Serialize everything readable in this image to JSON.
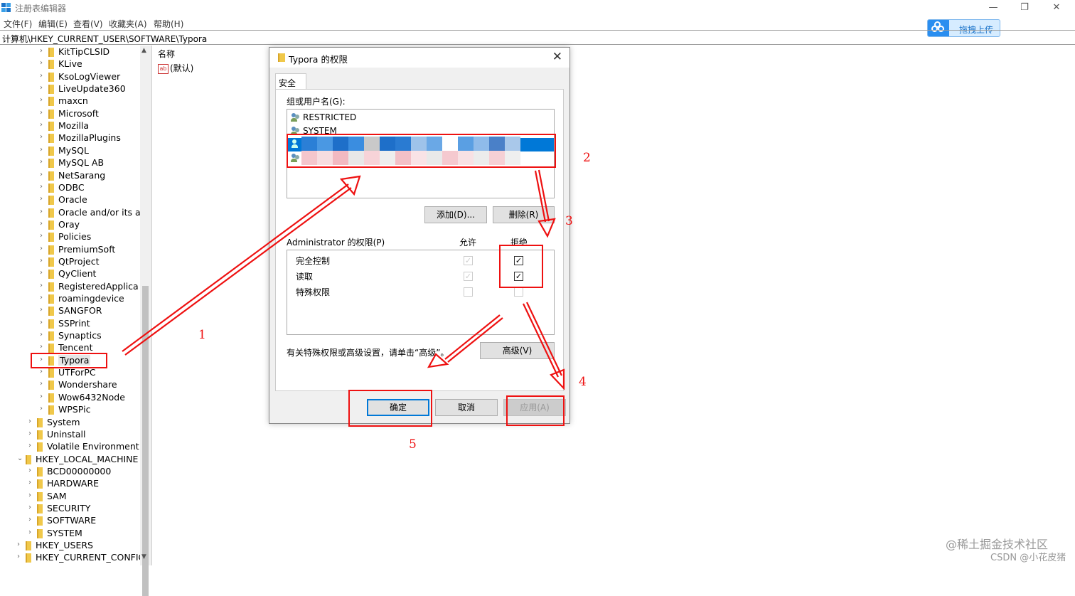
{
  "window": {
    "title": "注册表编辑器",
    "minimize": "—",
    "restore": "❐",
    "close": "✕"
  },
  "menu": [
    "文件(F)",
    "编辑(E)",
    "查看(V)",
    "收藏夹(A)",
    "帮助(H)"
  ],
  "address": "计算机\\HKEY_CURRENT_USER\\SOFTWARE\\Typora",
  "upload_button": "拖拽上传",
  "tree": {
    "software_children": [
      "KitTipCLSID",
      "KLive",
      "KsoLogViewer",
      "LiveUpdate360",
      "maxcn",
      "Microsoft",
      "Mozilla",
      "MozillaPlugins",
      "MySQL",
      "MySQL AB",
      "NetSarang",
      "ODBC",
      "Oracle",
      "Oracle and/or its af",
      "Oray",
      "Policies",
      "PremiumSoft",
      "QtProject",
      "QyClient",
      "RegisteredApplica",
      "roamingdevice",
      "SANGFOR",
      "SSPrint",
      "Synaptics",
      "Tencent",
      "Typora",
      "UTForPC",
      "Wondershare",
      "Wow6432Node",
      "WPSPic"
    ],
    "hkcu_children": [
      "System",
      "Uninstall",
      "Volatile Environment"
    ],
    "hklm": "HKEY_LOCAL_MACHINE",
    "hklm_children": [
      "BCD00000000",
      "HARDWARE",
      "SAM",
      "SECURITY",
      "SOFTWARE",
      "SYSTEM"
    ],
    "roots_after": [
      "HKEY_USERS",
      "HKEY_CURRENT_CONFIG"
    ],
    "selected": "Typora"
  },
  "list": {
    "column_name": "名称",
    "default_value": "(默认)",
    "value_icon": "ab"
  },
  "dialog": {
    "title": "Typora 的权限",
    "close": "✕",
    "tab_security": "安全",
    "group_label": "组或用户名(G):",
    "users": [
      "RESTRICTED",
      "SYSTEM"
    ],
    "partial_user_suffix": "s)",
    "add_button": "添加(D)...",
    "remove_button": "删除(R)",
    "perm_label": "Administrator 的权限(P)",
    "allow_header": "允许",
    "deny_header": "拒绝",
    "permissions": [
      {
        "name": "完全控制",
        "allow": true,
        "allow_disabled": true,
        "deny": true
      },
      {
        "name": "读取",
        "allow": true,
        "allow_disabled": true,
        "deny": true
      },
      {
        "name": "特殊权限",
        "allow": false,
        "allow_disabled": true,
        "deny": false
      }
    ],
    "advanced_hint": "有关特殊权限或高级设置，请单击“高级”。",
    "advanced_button": "高级(V)",
    "ok_button": "确定",
    "cancel_button": "取消",
    "apply_button": "应用(A)"
  },
  "annotations": {
    "color": "#ee1111",
    "numbers": [
      "1",
      "2",
      "3",
      "4",
      "5"
    ]
  },
  "watermarks": [
    "@稀土掘金技术社区",
    "CSDN @小花皮猪"
  ]
}
